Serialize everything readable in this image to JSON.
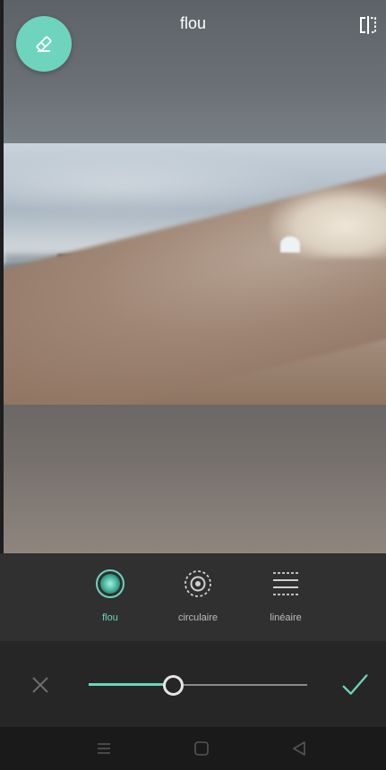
{
  "header": {
    "title": "flou",
    "eraser_icon": "eraser-icon",
    "compare_icon": "compare-split-icon"
  },
  "colors": {
    "accent": "#6ed4bd",
    "modebar_bg": "#303030",
    "sliderbar_bg": "#262626",
    "nav_bg": "#1a1a1a"
  },
  "modes": [
    {
      "label": "flou",
      "icon": "flou-blur-icon",
      "active": true
    },
    {
      "label": "circulaire",
      "icon": "circular-focus-icon",
      "active": false
    },
    {
      "label": "linéaire",
      "icon": "linear-focus-icon",
      "active": false
    }
  ],
  "slider": {
    "value_fraction": 0.38
  },
  "actions": {
    "cancel_icon": "close-icon",
    "confirm_icon": "check-icon"
  },
  "system_nav": {
    "icons": [
      "menu-icon",
      "home-icon",
      "back-icon"
    ]
  }
}
